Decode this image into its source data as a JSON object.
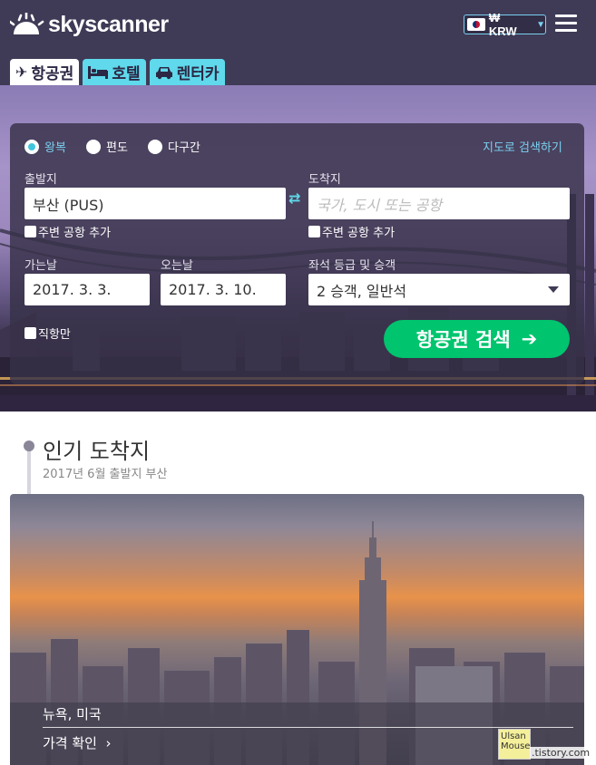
{
  "header": {
    "logo_text": "skyscanner",
    "currency": "₩ KRW",
    "tabs": [
      {
        "label": "항공권",
        "icon": "plane-icon"
      },
      {
        "label": "호텔",
        "icon": "bed-icon"
      },
      {
        "label": "렌터카",
        "icon": "car-icon"
      }
    ]
  },
  "search": {
    "trip_types": [
      "왕복",
      "편도",
      "다구간"
    ],
    "selected_trip_type": "왕복",
    "map_link": "지도로 검색하기",
    "origin_label": "출발지",
    "origin_value": "부산 (PUS)",
    "destination_label": "도착지",
    "destination_placeholder": "국가, 도시 또는 공항",
    "nearby_origin": "주변 공항 추가",
    "nearby_destination": "주변 공항 추가",
    "depart_label": "가는날",
    "depart_value": "2017. 3. 3.",
    "return_label": "오는날",
    "return_value": "2017. 3. 10.",
    "cabin_label": "좌석 등급 및 승객",
    "cabin_value": "2 승객, 일반석",
    "direct_only": "직항만",
    "search_button": "항공권 검색"
  },
  "popular": {
    "title": "인기 도착지",
    "subtitle": "2017년 6월    출발지 부산",
    "card": {
      "city": "뉴욕, 미국",
      "price_link": "가격 확인"
    }
  },
  "watermark": {
    "line1": "Ulsan",
    "line2": "Mouse",
    "site": ".tistory.com"
  },
  "colors": {
    "header_bg": "#3f3a56",
    "tab_accent": "#5fd9eb",
    "search_button": "#00c46e",
    "link": "#7ad0f0"
  }
}
